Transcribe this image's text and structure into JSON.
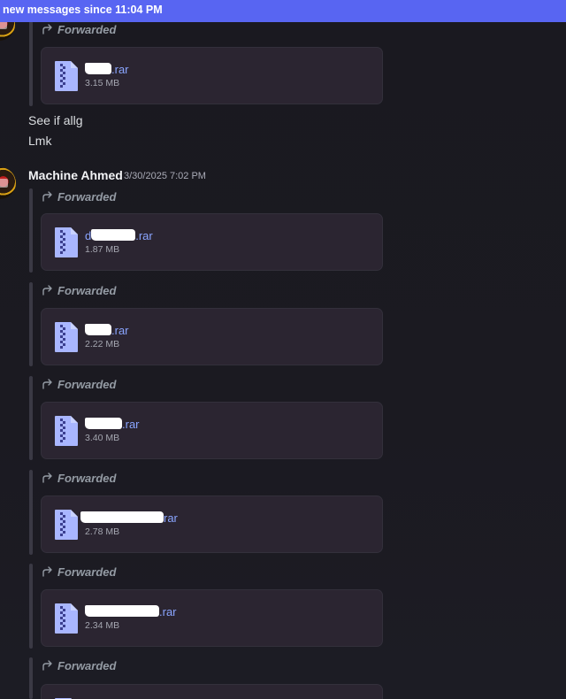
{
  "banner": {
    "text": "new messages since 11:04 PM"
  },
  "message_continuation": {
    "forwarded_label": "Forwarded",
    "attachment": {
      "name_suffix": ".rar",
      "size": "3.15 MB"
    },
    "lines": [
      "See if allg",
      "Lmk"
    ]
  },
  "message": {
    "author": "Machine Ahmed",
    "timestamp": "3/30/2025 7:02 PM",
    "forwards": [
      {
        "label": "Forwarded",
        "name_prefix": "d",
        "name_suffix": ".rar",
        "size": "1.87 MB"
      },
      {
        "label": "Forwarded",
        "name_prefix": "",
        "name_suffix": ".rar",
        "size": "2.22 MB"
      },
      {
        "label": "Forwarded",
        "name_prefix": "",
        "name_suffix": ".rar",
        "size": "3.40 MB"
      },
      {
        "label": "Forwarded",
        "name_prefix": "",
        "name_suffix": "rar",
        "size": "2.78 MB"
      },
      {
        "label": "Forwarded",
        "name_prefix": "",
        "name_suffix": ".rar",
        "size": "2.34 MB"
      },
      {
        "label": "Forwarded",
        "name_prefix": "",
        "name_suffix": "",
        "size": ""
      }
    ]
  },
  "icons": {
    "forward": "forward-arrow-icon",
    "file": "archive-file-icon"
  },
  "colors": {
    "banner": "#5865f2",
    "link": "#8aa5ff",
    "attachment_bg": "#2b2531",
    "file_icon": "#a9b6ff"
  }
}
